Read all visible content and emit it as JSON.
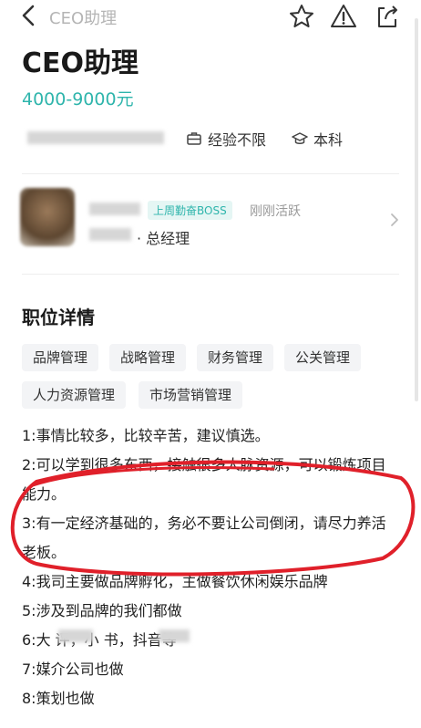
{
  "nav": {
    "title": "CEO助理"
  },
  "job": {
    "title": "CEO助理",
    "salary": "4000-9000元",
    "experience": "经验不限",
    "education": "本科"
  },
  "boss": {
    "badge": "上周勤奋BOSS",
    "active": "刚刚活跃",
    "role": "· 总经理"
  },
  "details": {
    "title": "职位详情",
    "tags": [
      "品牌管理",
      "战略管理",
      "财务管理",
      "公关管理",
      "人力资源管理",
      "市场营销管理"
    ],
    "lines": [
      "1:事情比较多，比较辛苦，建议慎选。",
      "2:可以学到很多东西，接触很多人脉资源，可以锻炼项目",
      "能力。",
      "3:有一定经济基础的，务必不要让公司倒闭，请尽力养活",
      "老板。",
      "4:我司主要做品牌孵化，主做餐饮休闲娱乐品牌",
      "5:涉及到品牌的我们都做",
      "6:大      评，小      书，抖音等",
      "7:媒介公司也做",
      "8:策划也做"
    ]
  },
  "colors": {
    "accent": "#2fb5ac",
    "annotation": "#e0202a"
  }
}
